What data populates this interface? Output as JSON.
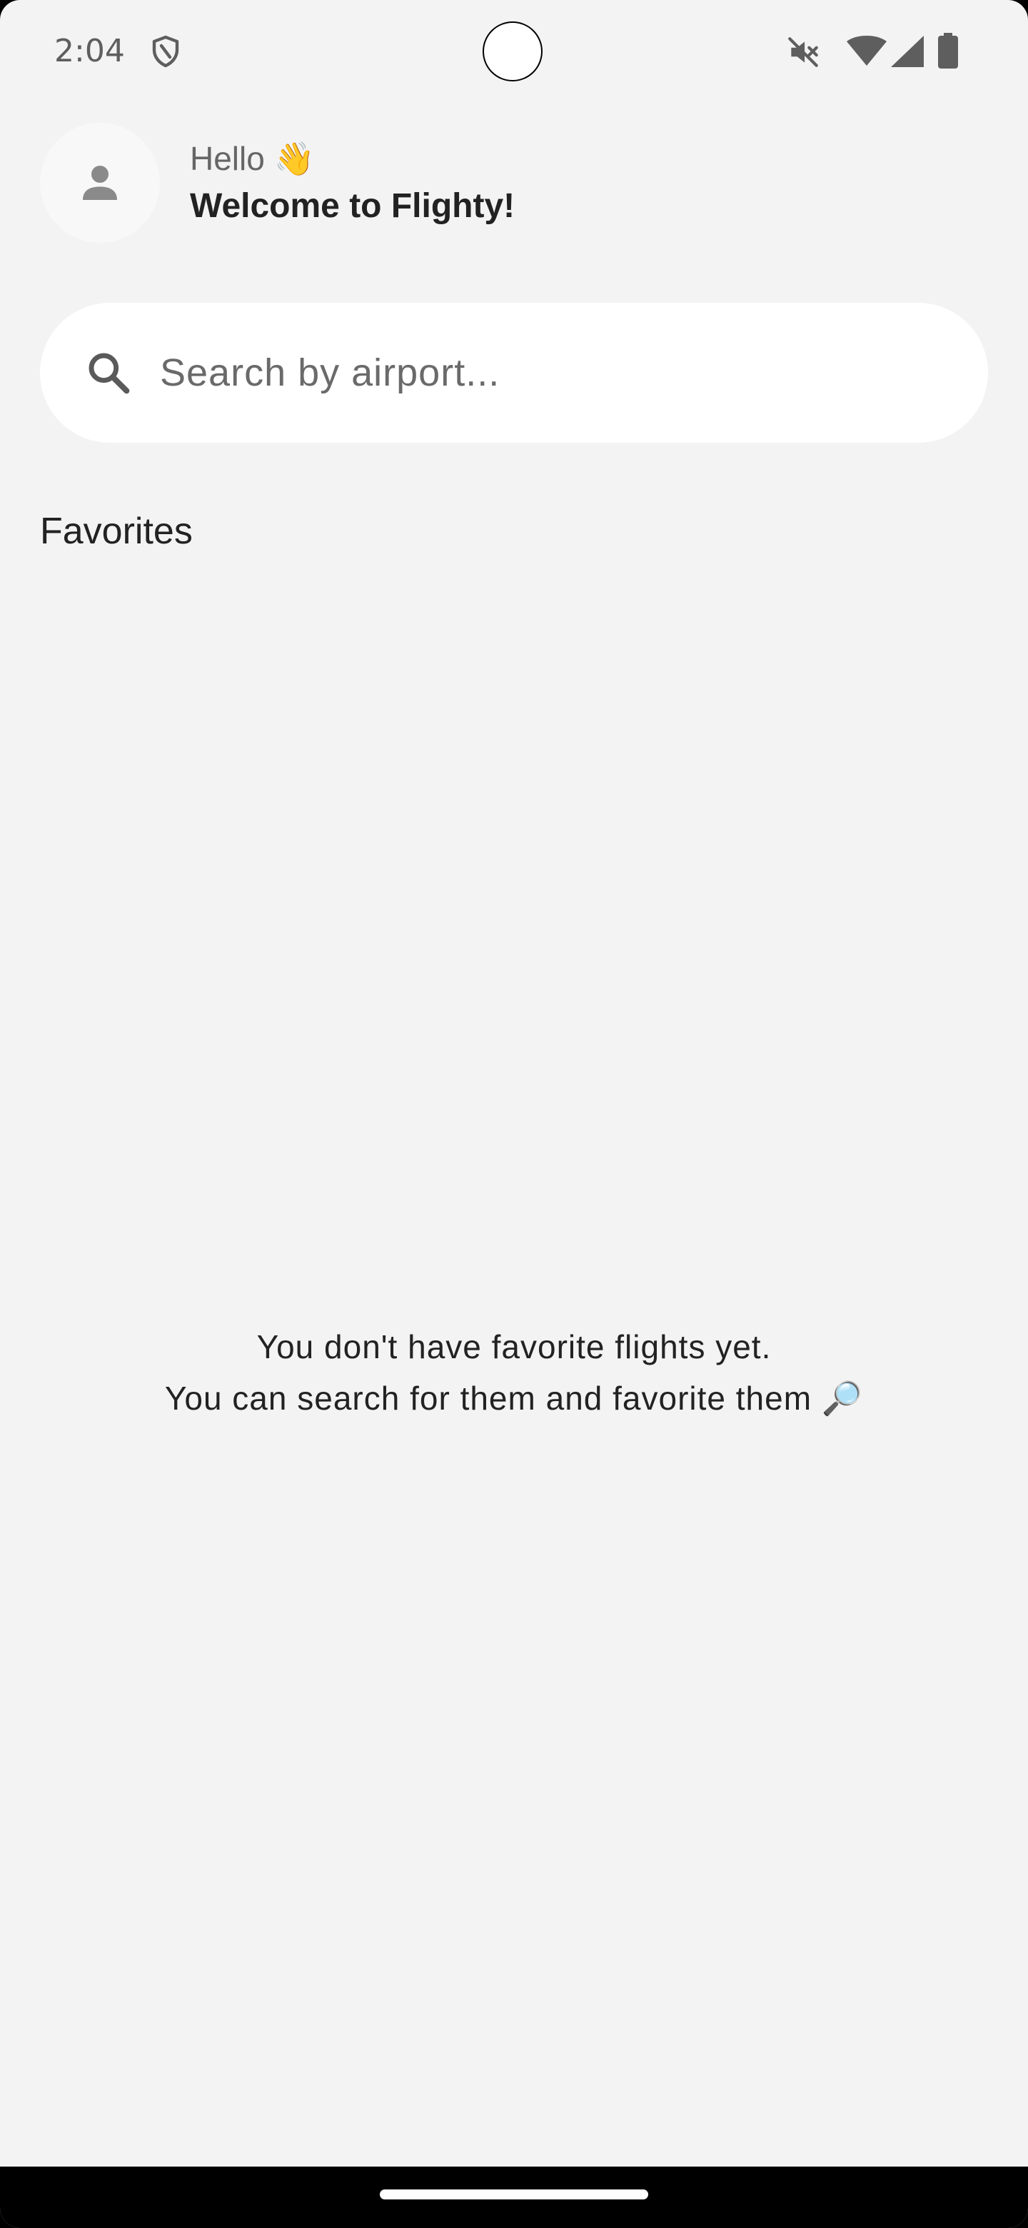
{
  "status_bar": {
    "time": "2:04",
    "icons": [
      "shield-icon",
      "mute-icon",
      "wifi-icon",
      "cell-signal-icon",
      "battery-icon"
    ]
  },
  "header": {
    "greeting": "Hello 👋",
    "welcome": "Welcome to Flighty!",
    "avatar_icon": "person-icon"
  },
  "search": {
    "placeholder": "Search by airport...",
    "value": "",
    "icon": "search-icon"
  },
  "favorites": {
    "title": "Favorites",
    "empty_line_1": "You don't have favorite flights yet.",
    "empty_line_2": "You can search for them and favorite them 🔎"
  },
  "colors": {
    "background": "#f3f3f3",
    "surface": "#ffffff",
    "text_primary": "#222222",
    "text_secondary": "#666666"
  }
}
